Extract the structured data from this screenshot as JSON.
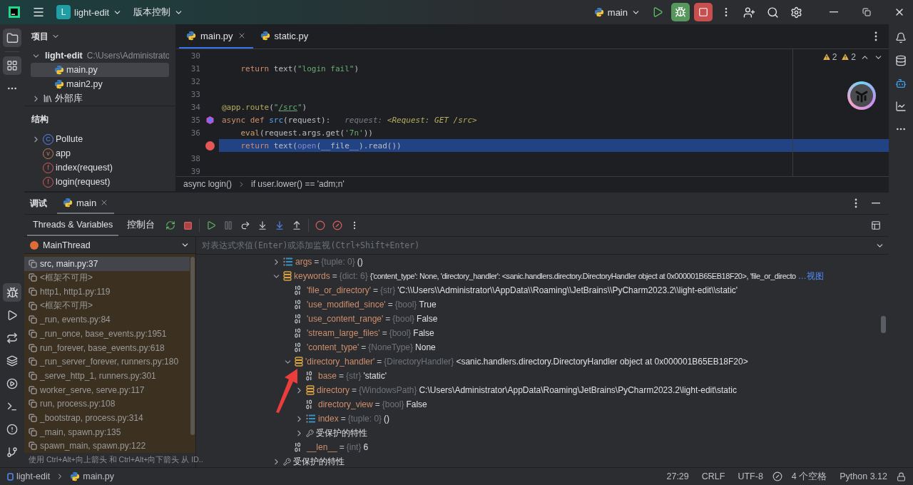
{
  "title_bar": {
    "project_badge": "L",
    "project": "light-edit",
    "vcs": "版本控制",
    "run_config": "main"
  },
  "project_panel": {
    "title": "项目",
    "tree": [
      {
        "kind": "folder",
        "label": "light-edit",
        "path": "C:\\Users\\Administrato",
        "expanded": true,
        "selected": false,
        "children": [
          {
            "kind": "python",
            "label": "main.py",
            "selected": true
          },
          {
            "kind": "python",
            "label": "main2.py",
            "selected": false
          }
        ]
      },
      {
        "kind": "library",
        "label": "外部库",
        "expanded": false,
        "selected": false
      }
    ]
  },
  "structure_panel": {
    "title": "结构",
    "items": [
      {
        "kind": "class",
        "badge": "C",
        "label": "Pollute",
        "expanded": false
      },
      {
        "kind": "variable",
        "badge": "v",
        "label": "app"
      },
      {
        "kind": "function",
        "badge": "f",
        "label": "index(request)"
      },
      {
        "kind": "function",
        "badge": "f",
        "label": "login(request)"
      }
    ]
  },
  "editor": {
    "tabs": [
      {
        "label": "main.py",
        "selected": true
      },
      {
        "label": "static.py",
        "selected": false
      }
    ],
    "inspections": [
      "2",
      "2"
    ],
    "lines": [
      {
        "number": "30",
        "current": false,
        "breakpoint": false,
        "frame_marker": false
      },
      {
        "number": "31",
        "current": false,
        "breakpoint": false,
        "frame_marker": false,
        "tokens": [
          {
            "text": "    return",
            "kind": "keyword"
          },
          {
            "text": " text(",
            "kind": "plain"
          },
          {
            "text": "\"login fail\"",
            "kind": "string"
          },
          {
            "text": ")",
            "kind": "plain"
          }
        ]
      },
      {
        "number": "32",
        "current": false,
        "breakpoint": false,
        "frame_marker": false
      },
      {
        "number": "33",
        "current": false,
        "breakpoint": false,
        "frame_marker": false
      },
      {
        "number": "34",
        "current": false,
        "breakpoint": false,
        "frame_marker": false,
        "tokens": [
          {
            "text": "@app.route",
            "kind": "decorator"
          },
          {
            "text": "(",
            "kind": "plain"
          },
          {
            "text": "\"",
            "kind": "string"
          },
          {
            "text": "/src",
            "kind": "link"
          },
          {
            "text": "\"",
            "kind": "string"
          },
          {
            "text": ")",
            "kind": "plain"
          }
        ]
      },
      {
        "number": "35",
        "current": false,
        "breakpoint": false,
        "frame_marker": true,
        "tokens": [
          {
            "text": "async def ",
            "kind": "keyword"
          },
          {
            "text": "src",
            "kind": "function"
          },
          {
            "text": "(request):",
            "kind": "plain"
          },
          {
            "text": "   request: ",
            "kind": "hint"
          },
          {
            "text": "<Request: GET /src>",
            "kind": "hintvalue"
          }
        ]
      },
      {
        "number": "36",
        "current": false,
        "breakpoint": false,
        "frame_marker": false,
        "tokens": [
          {
            "text": "    eval",
            "kind": "call"
          },
          {
            "text": "(request.args.get(",
            "kind": "plain"
          },
          {
            "text": "'7n'",
            "kind": "string"
          },
          {
            "text": "))",
            "kind": "plain"
          }
        ]
      },
      {
        "current": true,
        "breakpoint": true,
        "frame_marker": false,
        "tokens": [
          {
            "text": "    return",
            "kind": "keyword"
          },
          {
            "text": " text(",
            "kind": "plain"
          },
          {
            "text": "open",
            "kind": "builtin"
          },
          {
            "text": "(__file__).read())",
            "kind": "plain"
          }
        ]
      },
      {
        "number": "38",
        "current": false,
        "breakpoint": false,
        "frame_marker": false
      },
      {
        "number": "39",
        "current": false,
        "breakpoint": false,
        "frame_marker": false
      }
    ],
    "breadcrumbs": [
      "async login()",
      "if user.lower() == 'adm;n'"
    ]
  },
  "debug": {
    "title": "调试",
    "sessions": [
      {
        "label": "main",
        "selected": true
      }
    ],
    "views": [
      {
        "label": "Threads & Variables",
        "selected": true
      },
      {
        "label": "控制台",
        "selected": false
      }
    ],
    "thread": "MainThread",
    "frames": [
      {
        "label": "src, main.py:37",
        "selected": true,
        "library": false
      },
      {
        "label": "<框架不可用>",
        "selected": false,
        "library": true
      },
      {
        "label": "http1, http1.py:119",
        "selected": false,
        "library": true
      },
      {
        "label": "<框架不可用>",
        "selected": false,
        "library": true
      },
      {
        "label": "_run, events.py:84",
        "selected": false,
        "library": true
      },
      {
        "label": "_run_once, base_events.py:1951",
        "selected": false,
        "library": true
      },
      {
        "label": "run_forever, base_events.py:618",
        "selected": false,
        "library": true
      },
      {
        "label": "_run_server_forever, runners.py:180",
        "selected": false,
        "library": true
      },
      {
        "label": "_serve_http_1, runners.py:301",
        "selected": false,
        "library": true
      },
      {
        "label": "worker_serve, serve.py:117",
        "selected": false,
        "library": true
      },
      {
        "label": "run, process.py:108",
        "selected": false,
        "library": true
      },
      {
        "label": "_bootstrap, process.py:314",
        "selected": false,
        "library": true
      },
      {
        "label": "_main, spawn.py:135",
        "selected": false,
        "library": true
      },
      {
        "label": "spawn_main, spawn.py:122",
        "selected": false,
        "library": true
      }
    ],
    "frames_hint": "使用 Ctrl+Alt+向上箭头 和 Ctrl+Alt+向下箭头 从 ID..",
    "evaluate_placeholder": "对表达式求值(Enter)或添加监视(Ctrl+Shift+Enter)",
    "variables": [
      {
        "kind": "list",
        "name": "args",
        "eq": "=",
        "type": "{tuple: 0}",
        "value": "()",
        "expanded": false
      },
      {
        "kind": "dict",
        "name": "keywords",
        "eq": "=",
        "type": "{dict: 6}",
        "value": "{'content_type': None, 'directory_handler': <sanic.handlers.directory.DirectoryHandler object at 0x000001B65EB18F20>, 'file_or_directo",
        "link": "…视图",
        "expanded": true,
        "children": [
          {
            "kind": "primitive",
            "name": "'file_or_directory'",
            "eq": "=",
            "type": "{str}",
            "value": "'C:\\\\Users\\\\Administrator\\\\AppData\\\\Roaming\\\\JetBrains\\\\PyCharm2023.2\\\\light-edit\\\\static'"
          },
          {
            "kind": "primitive",
            "name": "'use_modified_since'",
            "eq": "=",
            "type": "{bool}",
            "value": "True"
          },
          {
            "kind": "primitive",
            "name": "'use_content_range'",
            "eq": "=",
            "type": "{bool}",
            "value": "False"
          },
          {
            "kind": "primitive",
            "name": "'stream_large_files'",
            "eq": "=",
            "type": "{bool}",
            "value": "False"
          },
          {
            "kind": "primitive",
            "name": "'content_type'",
            "eq": "=",
            "type": "{NoneType}",
            "value": "None"
          },
          {
            "kind": "dict",
            "name": "'directory_handler'",
            "eq": "=",
            "type": "{DirectoryHandler}",
            "value": "<sanic.handlers.directory.DirectoryHandler object at 0x000001B65EB18F20>",
            "expanded": true,
            "children": [
              {
                "kind": "primitive",
                "name": "base",
                "eq": "=",
                "type": "{str}",
                "value": "'static'"
              },
              {
                "kind": "dict",
                "name": "directory",
                "eq": "=",
                "type": "{WindowsPath}",
                "value": "C:\\Users\\Administrator\\AppData\\Roaming\\JetBrains\\PyCharm2023.2\\light-edit\\static",
                "expanded": false
              },
              {
                "kind": "primitive",
                "name": "directory_view",
                "eq": "=",
                "type": "{bool}",
                "value": "False"
              },
              {
                "kind": "list",
                "name": "index",
                "eq": "=",
                "type": "{tuple: 0}",
                "value": "()",
                "expanded": false
              },
              {
                "kind": "protected",
                "name": "受保护的特性",
                "expanded": false
              }
            ]
          },
          {
            "kind": "primitive",
            "name": "__len__",
            "eq": "=",
            "type": "{int}",
            "value": "6"
          }
        ]
      },
      {
        "kind": "protected",
        "name": "受保护的特性",
        "expanded": false
      }
    ]
  },
  "status_bar": {
    "path": [
      "light-edit",
      "main.py"
    ],
    "items": [
      "27:29",
      "CRLF",
      "UTF-8",
      "4 个空格",
      "Python 3.12"
    ]
  }
}
